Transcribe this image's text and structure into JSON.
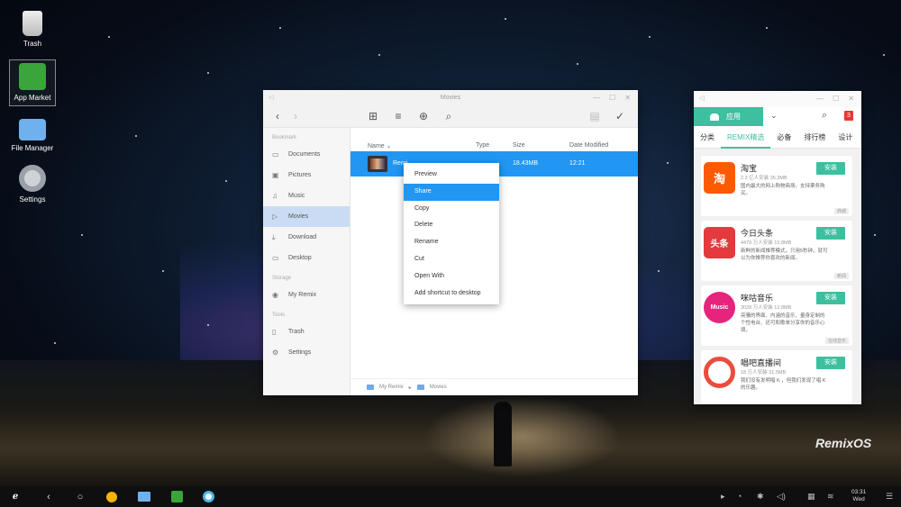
{
  "desktop": {
    "icons": [
      {
        "label": "Trash",
        "icon": "trash-icon"
      },
      {
        "label": "App Market",
        "icon": "app-market-icon"
      },
      {
        "label": "File Manager",
        "icon": "folder-icon"
      },
      {
        "label": "Settings",
        "icon": "gear-icon"
      }
    ],
    "watermark": "RemixOS"
  },
  "file_manager": {
    "title": "Movies",
    "sidebar": {
      "bookmark_header": "Bookmark",
      "bookmarks": [
        "Documents",
        "Pictures",
        "Music",
        "Movies",
        "Download",
        "Desktop"
      ],
      "storage_header": "Storage",
      "storage": [
        "My Remix"
      ],
      "tools_header": "Tools",
      "tools": [
        "Trash",
        "Settings"
      ]
    },
    "columns": {
      "name": "Name",
      "type": "Type",
      "size": "Size",
      "date": "Date Modified"
    },
    "rows": [
      {
        "name": "Remi",
        "size": "18.43MB",
        "date": "12:21"
      }
    ],
    "breadcrumb": [
      "My Remix",
      "Movies"
    ]
  },
  "context_menu": {
    "items": [
      "Preview",
      "Share",
      "Copy",
      "Delete",
      "Rename",
      "Cut",
      "Open With",
      "Add shortcut to desktop"
    ],
    "highlighted": "Share"
  },
  "app_market": {
    "category_tab": "应用",
    "notification_count": "3",
    "tabs": [
      "分类",
      "REMIX精选",
      "必备",
      "排行榜",
      "设计"
    ],
    "active_tab": "REMIX精选",
    "apps": [
      {
        "name": "淘宝",
        "meta": "2.3 亿人安装  35.3MB",
        "desc": "国内最大的网上购物商场，支持票务购买。",
        "install": "安装",
        "tag": "商城",
        "icon_text": "淘",
        "color": "#ff5a00"
      },
      {
        "name": "今日头条",
        "meta": "4479 万人安装  15.8MB",
        "desc": "新鲜的新闻推荐模式，只用5秒钟，就可以为你推荐你喜欢的新闻。",
        "install": "安装",
        "tag": "新闻",
        "icon_text": "头条",
        "color": "#e43a3d"
      },
      {
        "name": "咪咕音乐",
        "meta": "3028 万人安装  12.8MB",
        "desc": "亮骚的界面、内涵的音乐、量身定制的个性电台、还可和歌单分享你的音乐心境。",
        "install": "安装",
        "tag": "在线音乐",
        "icon_text": "Music",
        "color": "#e6247d"
      },
      {
        "name": "唱吧直播间",
        "meta": "18 万人安装  31.5MB",
        "desc": "我们没有发明唱 K ，但我们发现了唱 K 的乐趣。",
        "install": "安装",
        "tag": "",
        "icon_text": "",
        "color": "#ea4c3d"
      }
    ]
  },
  "taskbar": {
    "clock_time": "03:31",
    "clock_day": "Wed"
  }
}
